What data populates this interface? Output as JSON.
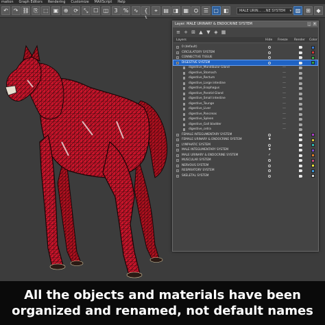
{
  "menubar": {
    "items": [
      "mation",
      "Graph Editors",
      "Rendering",
      "Customize",
      "MAXScript",
      "Help"
    ]
  },
  "toolbar": {
    "buttons": [
      "↶",
      "↷",
      "⛓",
      "⎘",
      "⬚",
      "▣",
      "⊕",
      "⟳",
      "⤡",
      "☐",
      "◫",
      "3",
      "%",
      "∿",
      "{ }",
      "⌖",
      "▤",
      "◨",
      "▦",
      "⛭",
      "☰",
      "▢",
      "◧",
      "▨",
      "⊞",
      "◆",
      "✱",
      "⋮",
      "⊟",
      "⧉",
      "◩",
      "⟰"
    ],
    "dropdown_value": "MALE URIN... ...NE SYSTEM"
  },
  "dialog": {
    "title": "Layer: MALE URINARY & ENDOCRINE SYSTEM",
    "toolbar_icons": [
      "≡",
      "+",
      "⊞",
      "▲",
      "▼",
      "◈",
      "▦"
    ],
    "headers": {
      "layers": "Layers",
      "hide": "Hide",
      "freeze": "Freeze",
      "render": "Render",
      "color": "Color"
    },
    "rows": [
      {
        "name": "0 (default)",
        "type": "layer",
        "hide": "circle",
        "color": "#3a7bd5"
      },
      {
        "name": "CIRCULATORY SYSTEM",
        "type": "layer",
        "hide": "circle",
        "color": "#d23a3a"
      },
      {
        "name": "CONNECTIVE TISSUE",
        "type": "layer",
        "hide": "circle",
        "color": "#3fb549"
      },
      {
        "name": "DIGESTIVE SYSTEM",
        "type": "layer",
        "hide": "circle",
        "color": "#2ea84a",
        "selected": true
      },
      {
        "name": "digestive_Mandibular Gland",
        "type": "object"
      },
      {
        "name": "digestive_Stomach",
        "type": "object"
      },
      {
        "name": "digestive_Rectum",
        "type": "object"
      },
      {
        "name": "digestive_Large intestine",
        "type": "object"
      },
      {
        "name": "digestive_Esophagus",
        "type": "object"
      },
      {
        "name": "digestive_Parotid Gland",
        "type": "object"
      },
      {
        "name": "digestive_Small intestine",
        "type": "object"
      },
      {
        "name": "digestive_Tounge",
        "type": "object"
      },
      {
        "name": "digestive_Liver",
        "type": "object"
      },
      {
        "name": "digestive_Pancreas",
        "type": "object"
      },
      {
        "name": "digestive_Spleen",
        "type": "object"
      },
      {
        "name": "digestive_Gall bladder",
        "type": "object"
      },
      {
        "name": "digestive_cetra",
        "type": "object"
      },
      {
        "name": "FEMALE INTEGUMENTARY SYSTEM",
        "type": "layer",
        "hide": "circle",
        "color": "#a83cc4"
      },
      {
        "name": "FEMALE URINARY & ENDOCRINE SYSTEM",
        "type": "layer",
        "hide": "bulb",
        "color": "#d8c838"
      },
      {
        "name": "LYMPHATIC SYSTEM",
        "type": "layer",
        "hide": "circle",
        "color": "#2bb5b0"
      },
      {
        "name": "MALE INTEGUMENTARY SYSTEM",
        "type": "layer",
        "hide": "bulb",
        "color": "#7a4bd0"
      },
      {
        "name": "MALE URINARY & ENDOCRINE SYSTEM",
        "type": "layer",
        "hide": "check",
        "color": "#e07a2a"
      },
      {
        "name": "MUSCULAR SYSTEM",
        "type": "layer",
        "hide": "circle",
        "color": "#c44a7a"
      },
      {
        "name": "NERVOUS SYSTEM",
        "type": "layer",
        "hide": "circle",
        "color": "#e8e038"
      },
      {
        "name": "RESPIRATORY SYSTEM",
        "type": "layer",
        "hide": "circle",
        "color": "#3a9be0"
      },
      {
        "name": "SKELETAL SYSTEM",
        "type": "layer",
        "hide": "circle",
        "color": "#d0d0d0"
      }
    ]
  },
  "caption": {
    "line1": "All the objects and materials have been",
    "line2": "organized and renamed, not default names"
  },
  "colors": {
    "muscle": "#c8142a",
    "selection": "#1f63c4",
    "caption_bg": "#0a0a0a"
  }
}
